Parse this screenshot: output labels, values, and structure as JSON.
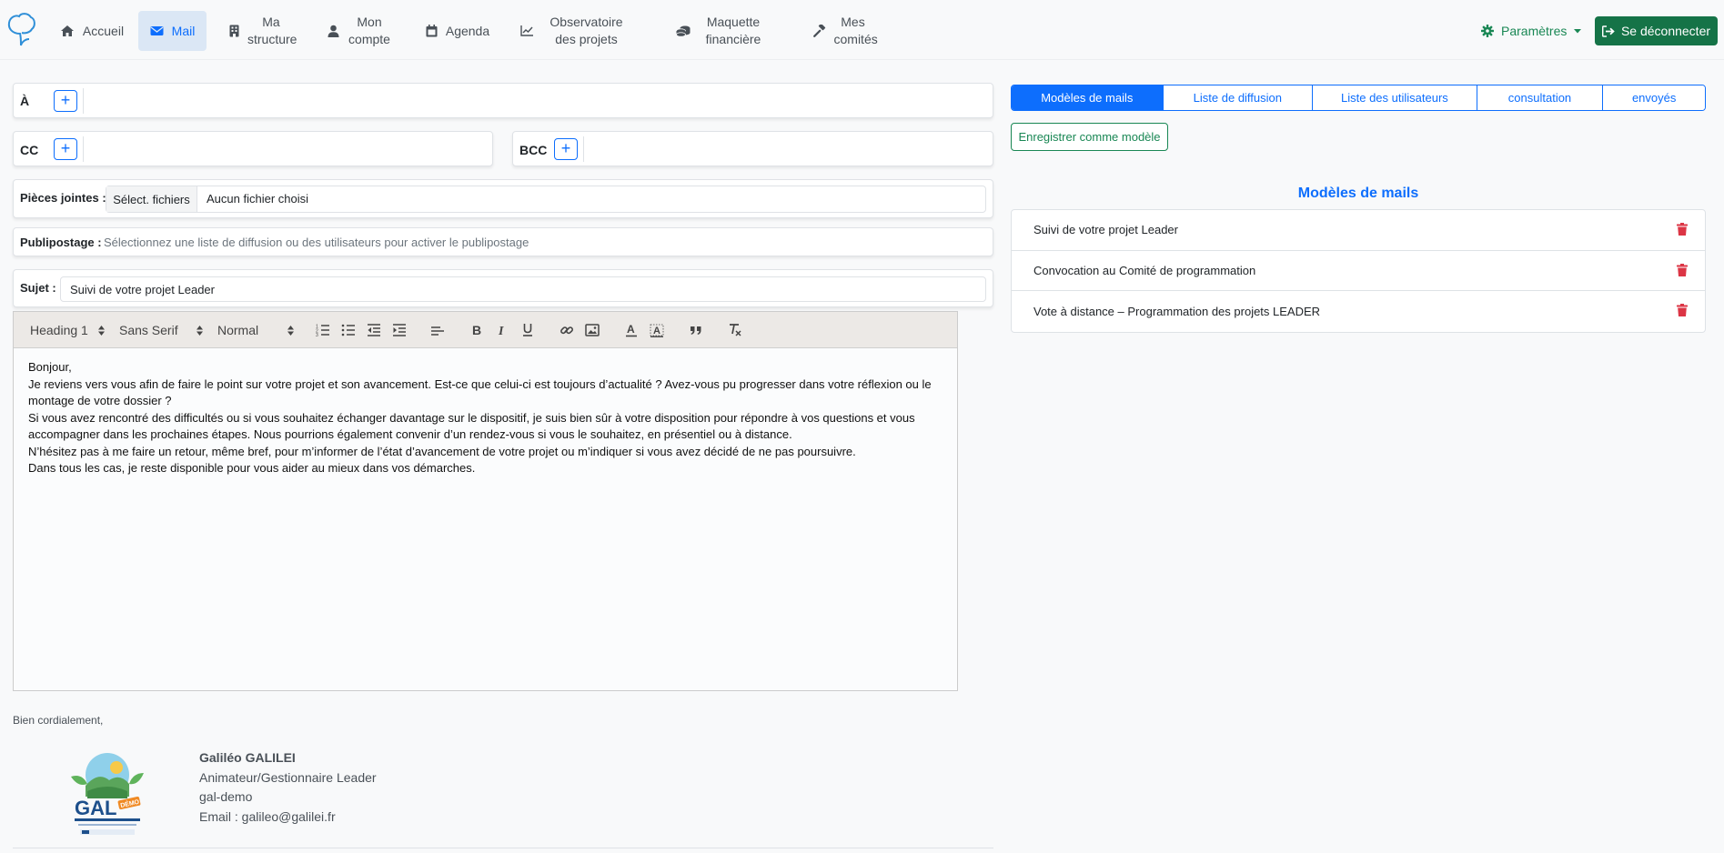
{
  "nav": {
    "items": [
      {
        "label": "Accueil",
        "icon": "home-icon"
      },
      {
        "label": "Mail",
        "icon": "envelope-icon",
        "active": true
      },
      {
        "label": "Ma structure",
        "icon": "building-icon"
      },
      {
        "label": "Mon compte",
        "icon": "user-icon"
      },
      {
        "label": "Agenda",
        "icon": "calendar-icon"
      },
      {
        "label": "Observatoire des projets",
        "icon": "chart-line-icon"
      },
      {
        "label": "Maquette financière",
        "icon": "coins-icon"
      },
      {
        "label": "Mes comités",
        "icon": "gavel-icon"
      }
    ],
    "settings_label": "Paramètres",
    "logout_label": "Se déconnecter"
  },
  "colors": {
    "primary": "#0d6efd",
    "success": "#198754",
    "danger": "#dc3545",
    "nav_active_bg": "#dbe7f5"
  },
  "form": {
    "to_label": "À",
    "cc_label": "CC",
    "bcc_label": "BCC",
    "plus_symbol": "+",
    "attachments_label": "Pièces jointes :",
    "file_button_label": "Sélect. fichiers",
    "file_status": "Aucun fichier choisi",
    "mailmerge_label": "Publipostage :",
    "mailmerge_hint": "Sélectionnez une liste de diffusion ou des utilisateurs pour activer le publipostage",
    "subject_label": "Sujet :",
    "subject_value": "Suivi de votre projet Leader"
  },
  "editor": {
    "heading_select": "Heading 1",
    "font_select": "Sans Serif",
    "size_select": "Normal",
    "body": [
      "Bonjour,",
      "Je reviens vers vous afin de faire le point sur votre projet et son avancement. Est-ce que celui-ci est toujours d’actualité ? Avez-vous pu progresser dans votre réflexion ou le montage de votre dossier ?",
      "Si vous avez rencontré des difficultés ou si vous souhaitez échanger davantage sur le dispositif, je suis bien sûr à votre disposition pour répondre à vos questions et vous accompagner dans les prochaines étapes. Nous pourrions également convenir d’un rendez-vous si vous le souhaitez, en présentiel ou à distance.",
      "N’hésitez pas à me faire un retour, même bref, pour m’informer de l’état d’avancement de votre projet ou m’indiquer si vous avez décidé de ne pas poursuivre.",
      "Dans tous les cas, je reste disponible pour vous aider au mieux dans vos démarches."
    ]
  },
  "signature": {
    "closing": "Bien cordialement,",
    "name": "Galiléo GALILEI",
    "role": "Animateur/Gestionnaire Leader",
    "org": "gal-demo",
    "email": "Email : galileo@galilei.fr",
    "logo_text": "GAL",
    "logo_badge": "DÉMO"
  },
  "right": {
    "tabs": [
      "Modèles de mails",
      "Liste de diffusion",
      "Liste des utilisateurs",
      "consultation",
      "envoyés"
    ],
    "save_template_label": "Enregistrer comme modèle",
    "templates_title": "Modèles de mails",
    "templates": [
      "Suivi de votre projet Leader",
      "Convocation au Comité de programmation",
      "Vote à distance – Programmation des projets LEADER"
    ]
  }
}
